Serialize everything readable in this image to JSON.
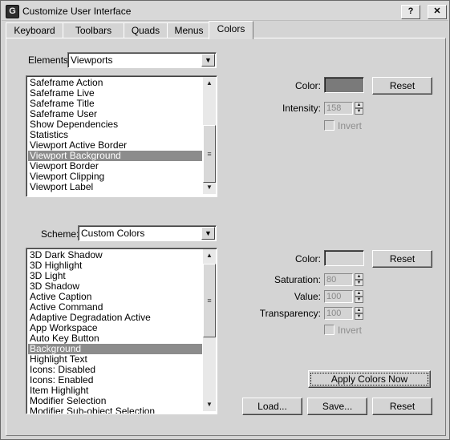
{
  "window": {
    "title": "Customize User Interface",
    "help_button": "?",
    "close_button": "✕"
  },
  "tabs": [
    {
      "label": "Keyboard"
    },
    {
      "label": "Toolbars"
    },
    {
      "label": "Quads"
    },
    {
      "label": "Menus"
    },
    {
      "label": "Colors",
      "active": true
    }
  ],
  "elements_section": {
    "label": "Elements:",
    "selected": "Viewports",
    "items": [
      "Safeframe Action",
      "Safeframe Live",
      "Safeframe Title",
      "Safeframe User",
      "Show Dependencies",
      "Statistics",
      "Viewport Active Border",
      "Viewport Background",
      "Viewport Border",
      "Viewport Clipping",
      "Viewport Label"
    ],
    "selected_item": "Viewport Background",
    "color_label": "Color:",
    "color_value": "#7a7a7a",
    "reset_label": "Reset",
    "intensity_label": "Intensity:",
    "intensity_value": "158",
    "invert_label": "Invert"
  },
  "scheme_section": {
    "label": "Scheme:",
    "selected": "Custom Colors",
    "items": [
      "3D Dark Shadow",
      "3D Highlight",
      "3D Light",
      "3D Shadow",
      "Active Caption",
      "Active Command",
      "Adaptive Degradation Active",
      "App Workspace",
      "Auto Key Button",
      "Background",
      "Highlight Text",
      "Icons: Disabled",
      "Icons: Enabled",
      "Item Highlight",
      "Modifier Selection",
      "Modifier Sub-object Selection"
    ],
    "selected_item": "Background",
    "color_label": "Color:",
    "color_value": "#d4d4d4",
    "reset_label": "Reset",
    "saturation_label": "Saturation:",
    "saturation_value": "80",
    "value_label": "Value:",
    "value_value": "100",
    "transparency_label": "Transparency:",
    "transparency_value": "100",
    "invert_label": "Invert"
  },
  "footer": {
    "apply_label": "Apply Colors Now",
    "load_label": "Load...",
    "save_label": "Save...",
    "reset_label": "Reset"
  }
}
